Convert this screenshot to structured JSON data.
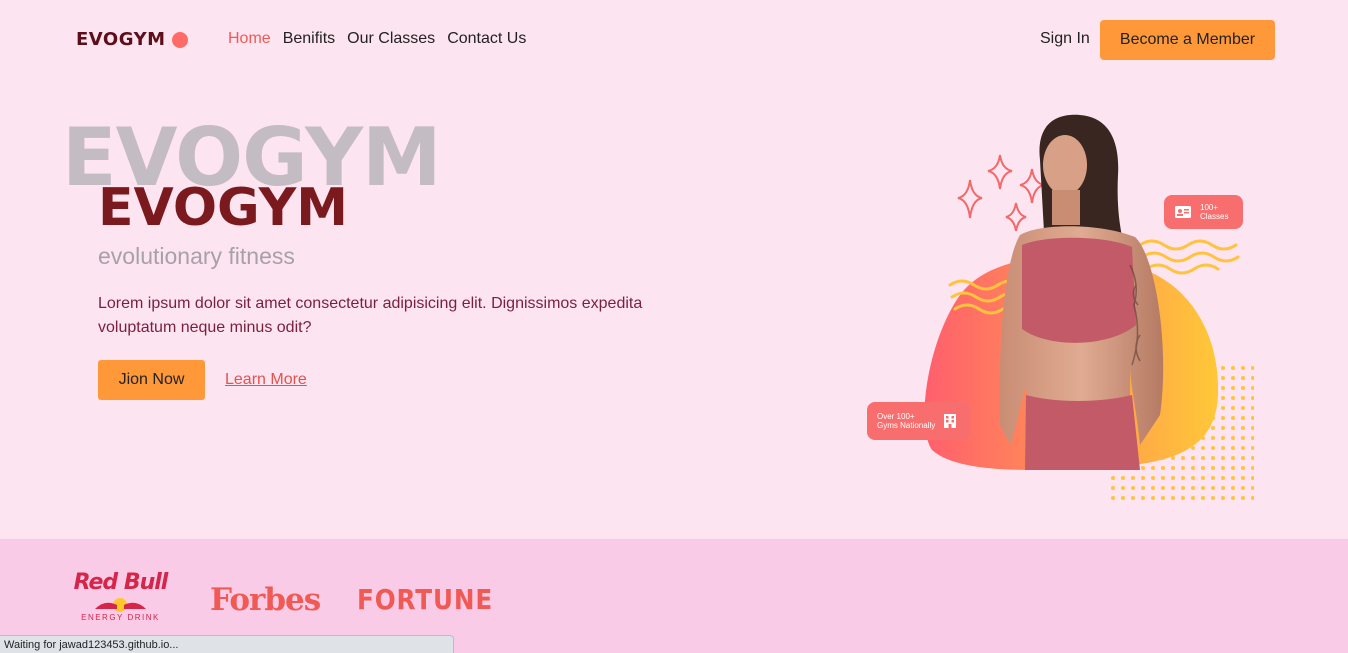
{
  "brand": {
    "name": "EVOGYM"
  },
  "nav": {
    "links": [
      {
        "label": "Home",
        "active": true
      },
      {
        "label": "Benifits",
        "active": false
      },
      {
        "label": "Our Classes",
        "active": false
      },
      {
        "label": "Contact Us",
        "active": false
      }
    ],
    "sign_in": "Sign In",
    "member_button": "Become a Member"
  },
  "hero": {
    "bg_text": "EVOGYM",
    "title": "EVOGYM",
    "subtitle": "evolutionary fitness",
    "description": "Lorem ipsum dolor sit amet consectetur adipisicing elit. Dignissimos expedita voluptatum neque minus odit?",
    "join_button": "Jion Now",
    "learn_more": "Learn More"
  },
  "graphic": {
    "badge_classes": {
      "line1": "100+",
      "line2": "Classes",
      "icon": "id-card-icon"
    },
    "badge_gyms": {
      "line1": "Over 100+",
      "line2": "Gyms Nationally",
      "icon": "building-icon"
    }
  },
  "sponsors": {
    "redbull": {
      "name": "Red Bull",
      "sub": "ENERGY DRINK"
    },
    "forbes": "Forbes",
    "fortune": "FORTUNE"
  },
  "status_bar": "Waiting for jawad123453.github.io...",
  "colors": {
    "background": "#fde4f1",
    "accent": "#ff9838",
    "secondary": "#f05a55",
    "dark": "#7a1a1f",
    "sponsor_bg": "#facbe6"
  }
}
